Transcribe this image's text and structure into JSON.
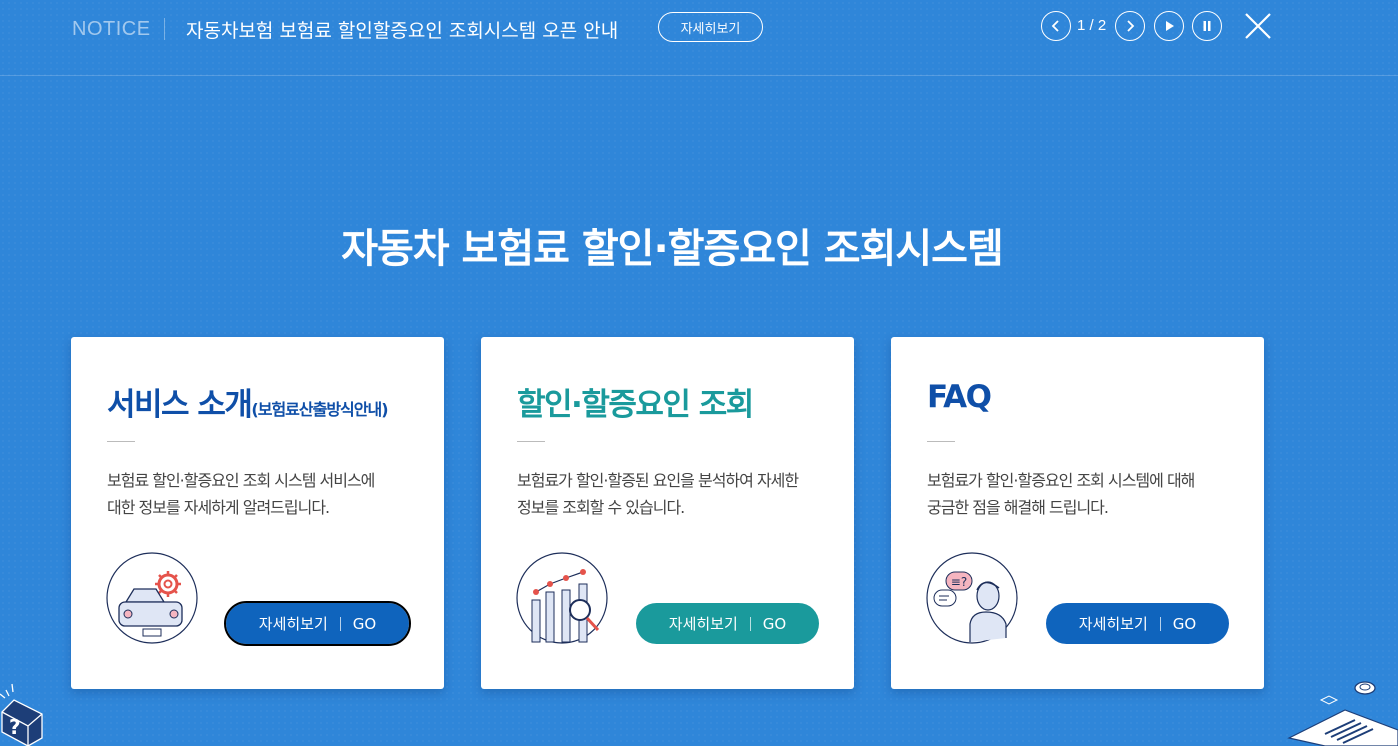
{
  "notice": {
    "label": "NOTICE",
    "text": "자동차보험 보험료 할인할증요인 조회시스템 오픈 안내",
    "detail_button": "자세히보기",
    "pager": "1 / 2"
  },
  "main_title": "자동차 보험료 할인·할증요인 조회시스템",
  "cards": [
    {
      "title": "서비스 소개",
      "subtitle": "(보험료산출방식안내)",
      "desc": "보험료 할인·할증요인 조회 시스템 서비스에\n대한 정보를 자세하게 알려드립니다.",
      "button_label": "자세히보기",
      "button_go": "GO",
      "title_color": "#0f4fa8",
      "icon": "car-gear-icon"
    },
    {
      "title": "할인·할증요인 조회",
      "subtitle": "",
      "desc": "보험료가 할인·할증된 요인을 분석하여 자세한\n정보를 조회할 수 있습니다.",
      "button_label": "자세히보기",
      "button_go": "GO",
      "title_color": "#1a9a9c",
      "icon": "chart-magnifier-icon"
    },
    {
      "title": "FAQ",
      "subtitle": "",
      "desc": "보험료가 할인·할증요인 조회 시스템에 대해\n궁금한 점을 해결해 드립니다.",
      "button_label": "자세히보기",
      "button_go": "GO",
      "title_color": "#0f4fa8",
      "icon": "person-speech-icon"
    }
  ],
  "colors": {
    "background": "#2f86d9",
    "button_blue": "#0f64bd",
    "button_teal": "#1a9a9c"
  }
}
